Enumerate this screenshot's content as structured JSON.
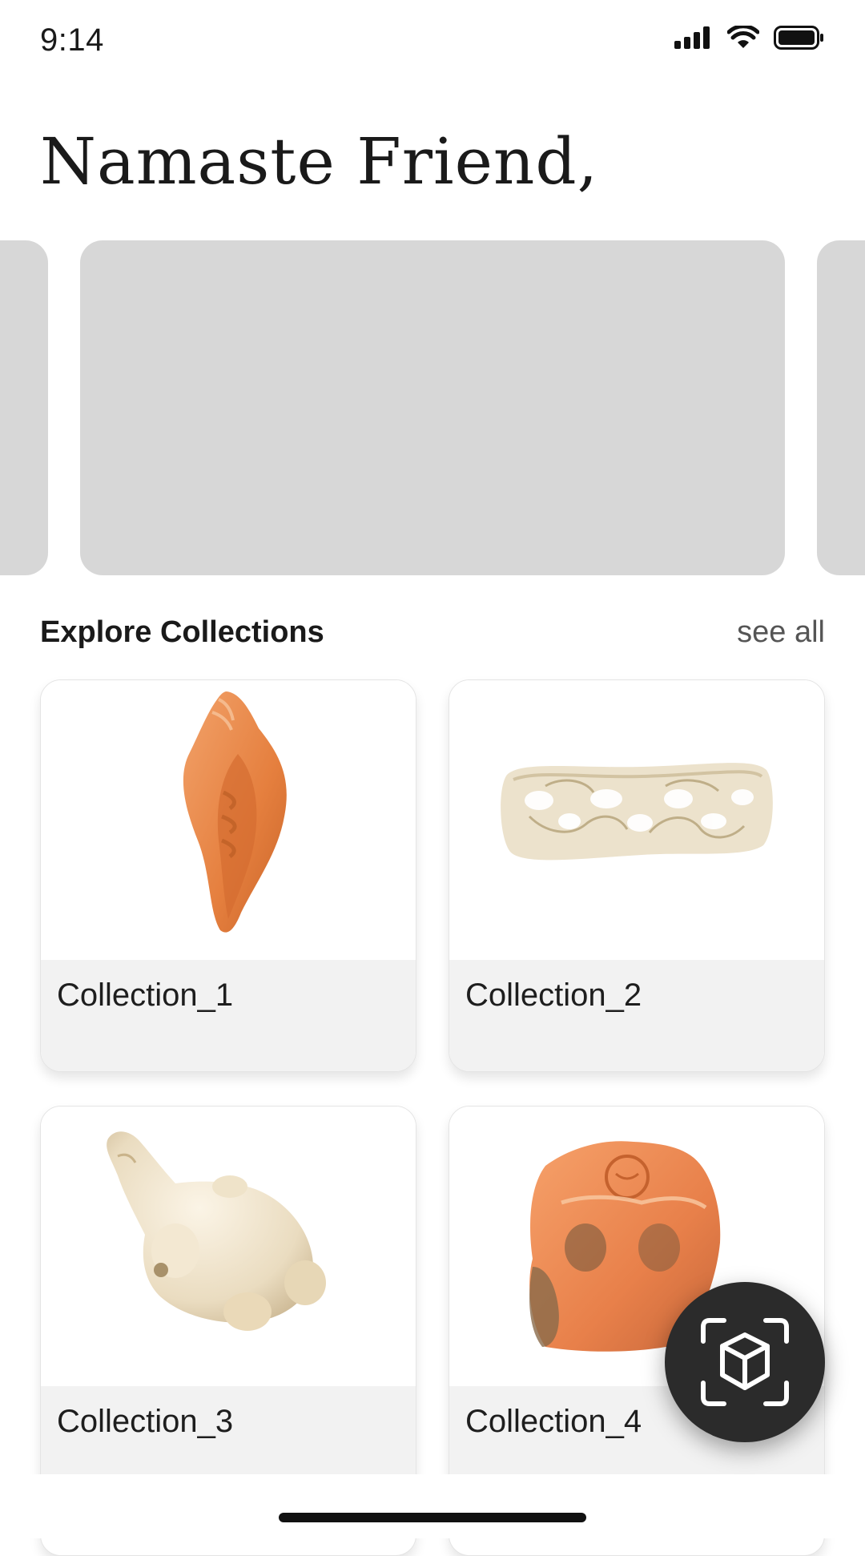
{
  "status_bar": {
    "time": "9:14"
  },
  "header": {
    "greeting": "Namaste Friend,"
  },
  "carousel": {
    "banners": [
      "",
      "",
      ""
    ]
  },
  "section": {
    "title": "Explore Collections",
    "see_all": "see all"
  },
  "collections": [
    {
      "name": "Collection_1",
      "image": "conch-shell"
    },
    {
      "name": "Collection_2",
      "image": "carved-ivory-ring"
    },
    {
      "name": "Collection_3",
      "image": "white-animal-figurine"
    },
    {
      "name": "Collection_4",
      "image": "orange-carved-figure"
    }
  ],
  "fab": {
    "icon": "ar-cube-scan-icon"
  },
  "colors": {
    "banner": "#d7d7d7",
    "card_label_bg": "#f2f2f2",
    "fab": "#2b2b2b",
    "text": "#1a1a1a"
  }
}
